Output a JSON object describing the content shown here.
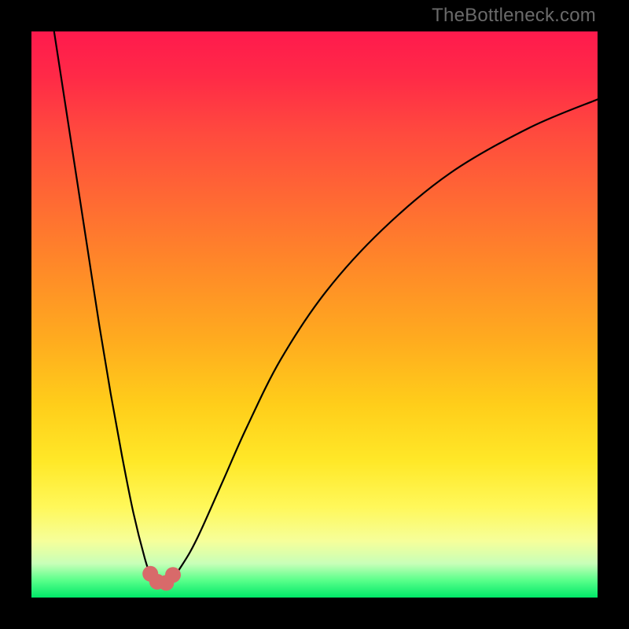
{
  "watermark": "TheBottleneck.com",
  "chart_data": {
    "type": "line",
    "title": "",
    "xlabel": "",
    "ylabel": "",
    "xlim": [
      0,
      100
    ],
    "ylim": [
      0,
      100
    ],
    "grid": false,
    "legend": false,
    "series": [
      {
        "name": "bottleneck-curve",
        "color": "#000000",
        "x": [
          4,
          6,
          8,
          10,
          12,
          14,
          16,
          18,
          20,
          21,
          22,
          23,
          24,
          25,
          26,
          28,
          30,
          34,
          38,
          44,
          52,
          62,
          74,
          88,
          100
        ],
        "y": [
          100,
          87,
          74,
          61,
          48,
          36,
          25,
          15,
          7,
          4.2,
          2.8,
          2.3,
          2.4,
          3.2,
          4.8,
          8,
          12,
          21,
          30,
          42,
          54,
          65,
          75,
          83,
          88
        ]
      }
    ],
    "markers": [
      {
        "name": "valley-marker-1",
        "x": 21,
        "y": 4.2,
        "color": "#d86a6a"
      },
      {
        "name": "valley-marker-2",
        "x": 22.2,
        "y": 2.8,
        "color": "#d86a6a"
      },
      {
        "name": "valley-marker-3",
        "x": 23.8,
        "y": 2.6,
        "color": "#d86a6a"
      },
      {
        "name": "valley-marker-4",
        "x": 25,
        "y": 4.0,
        "color": "#d86a6a"
      }
    ],
    "annotations": []
  }
}
